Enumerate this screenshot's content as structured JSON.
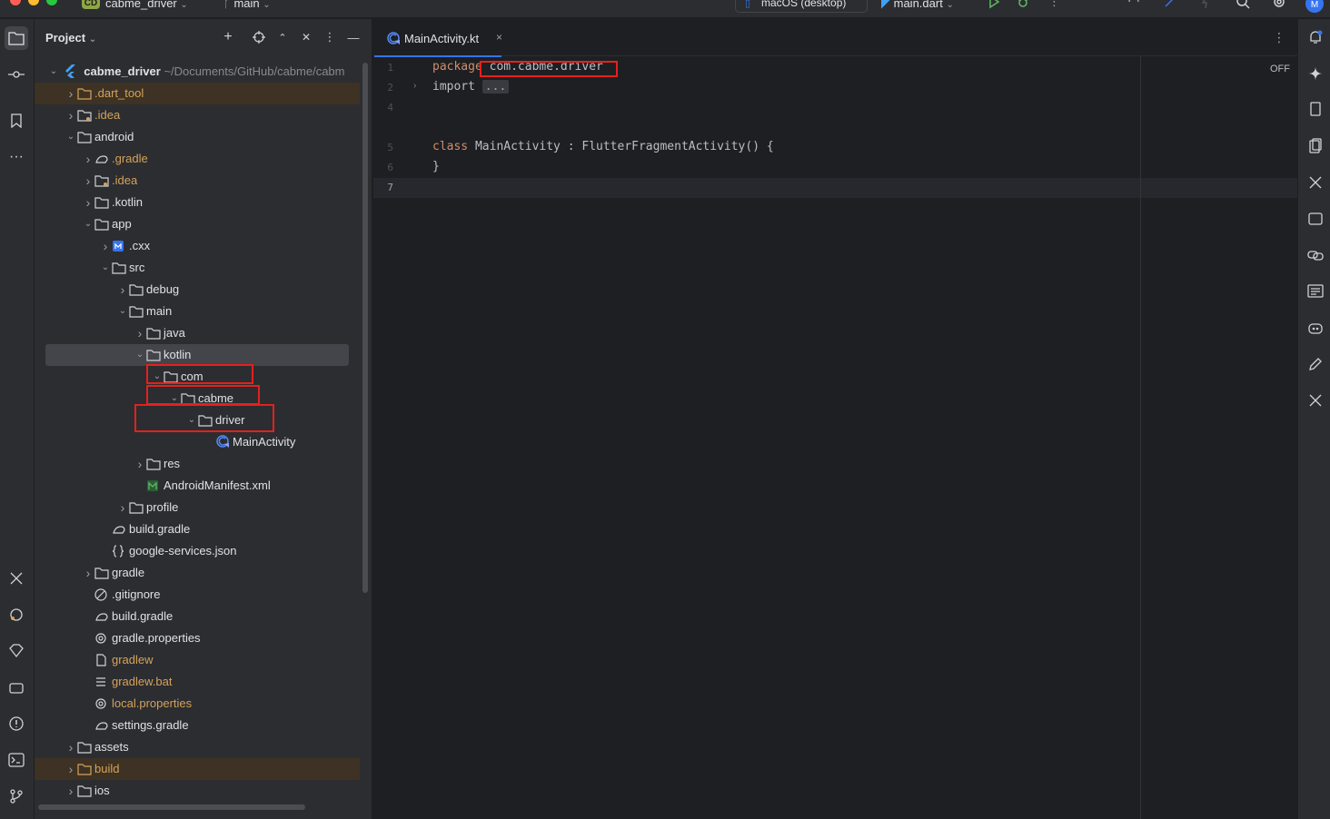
{
  "titlebar": {
    "project_badge": "CD",
    "project_name": "cabme_driver",
    "branch": "main",
    "run_target": "macOS (desktop)",
    "run_file": "main.dart",
    "avatar": "M"
  },
  "project_panel": {
    "title": "Project",
    "root": {
      "name": "cabme_driver",
      "path": "~/Documents/GitHub/cabme/cabm"
    },
    "tree": [
      {
        "label": ".dart_tool",
        "depth": 1,
        "chev": "right",
        "icon": "folder-excluded-icon",
        "style": "orange",
        "hl": "excluded"
      },
      {
        "label": ".idea",
        "depth": 1,
        "chev": "right",
        "icon": "folder-settings-icon",
        "style": "orange"
      },
      {
        "label": "android",
        "depth": 1,
        "chev": "down",
        "icon": "folder-icon",
        "style": "normal"
      },
      {
        "label": ".gradle",
        "depth": 2,
        "chev": "right",
        "icon": "gradle-folder-icon",
        "style": "orange"
      },
      {
        "label": ".idea",
        "depth": 2,
        "chev": "right",
        "icon": "folder-settings-icon",
        "style": "orange"
      },
      {
        "label": ".kotlin",
        "depth": 2,
        "chev": "right",
        "icon": "folder-icon",
        "style": "normal"
      },
      {
        "label": "app",
        "depth": 2,
        "chev": "down",
        "icon": "folder-icon",
        "style": "normal"
      },
      {
        "label": ".cxx",
        "depth": 3,
        "chev": "right",
        "icon": "module-icon",
        "style": "normal"
      },
      {
        "label": "src",
        "depth": 3,
        "chev": "down",
        "icon": "folder-icon",
        "style": "normal"
      },
      {
        "label": "debug",
        "depth": 4,
        "chev": "right",
        "icon": "folder-icon",
        "style": "normal"
      },
      {
        "label": "main",
        "depth": 4,
        "chev": "down",
        "icon": "folder-icon",
        "style": "normal"
      },
      {
        "label": "java",
        "depth": 5,
        "chev": "right",
        "icon": "folder-icon",
        "style": "normal"
      },
      {
        "label": "kotlin",
        "depth": 5,
        "chev": "down",
        "icon": "folder-icon",
        "style": "normal",
        "hl": "selected"
      },
      {
        "label": "com",
        "depth": 6,
        "chev": "down",
        "icon": "folder-icon",
        "style": "normal"
      },
      {
        "label": "cabme",
        "depth": 7,
        "chev": "down",
        "icon": "folder-icon",
        "style": "normal"
      },
      {
        "label": "driver",
        "depth": 8,
        "chev": "down",
        "icon": "folder-icon",
        "style": "normal"
      },
      {
        "label": "MainActivity",
        "depth": 9,
        "chev": "none",
        "icon": "kotlin-class-icon",
        "style": "normal"
      },
      {
        "label": "res",
        "depth": 5,
        "chev": "right",
        "icon": "folder-icon",
        "style": "normal"
      },
      {
        "label": "AndroidManifest.xml",
        "depth": 5,
        "chev": "none",
        "icon": "manifest-icon",
        "style": "normal"
      },
      {
        "label": "profile",
        "depth": 4,
        "chev": "right",
        "icon": "folder-icon",
        "style": "normal"
      },
      {
        "label": "build.gradle",
        "depth": 3,
        "chev": "none",
        "icon": "gradle-icon",
        "style": "normal"
      },
      {
        "label": "google-services.json",
        "depth": 3,
        "chev": "none",
        "icon": "json-icon",
        "style": "normal"
      },
      {
        "label": "gradle",
        "depth": 2,
        "chev": "right",
        "icon": "folder-icon",
        "style": "normal"
      },
      {
        "label": ".gitignore",
        "depth": 2,
        "chev": "none",
        "icon": "ignore-icon",
        "style": "normal"
      },
      {
        "label": "build.gradle",
        "depth": 2,
        "chev": "none",
        "icon": "gradle-icon",
        "style": "normal"
      },
      {
        "label": "gradle.properties",
        "depth": 2,
        "chev": "none",
        "icon": "properties-icon",
        "style": "normal"
      },
      {
        "label": "gradlew",
        "depth": 2,
        "chev": "none",
        "icon": "file-icon",
        "style": "orange"
      },
      {
        "label": "gradlew.bat",
        "depth": 2,
        "chev": "none",
        "icon": "text-file-icon",
        "style": "orange"
      },
      {
        "label": "local.properties",
        "depth": 2,
        "chev": "none",
        "icon": "properties-icon",
        "style": "orange"
      },
      {
        "label": "settings.gradle",
        "depth": 2,
        "chev": "none",
        "icon": "gradle-icon",
        "style": "normal"
      },
      {
        "label": "assets",
        "depth": 1,
        "chev": "right",
        "icon": "folder-icon",
        "style": "normal"
      },
      {
        "label": "build",
        "depth": 1,
        "chev": "right",
        "icon": "folder-excluded-icon",
        "style": "orange",
        "hl": "excluded"
      },
      {
        "label": "ios",
        "depth": 1,
        "chev": "right",
        "icon": "folder-icon",
        "style": "normal"
      }
    ]
  },
  "editor": {
    "tab_label": "MainActivity.kt",
    "tab_close": "×",
    "inlay_off": "OFF",
    "line_numbers": [
      "1",
      "2",
      "4",
      "5",
      "6",
      "7"
    ],
    "lines": [
      {
        "kw": "package",
        "rest": " com.cabme.driver"
      },
      {
        "kw": "import",
        "rest": " ",
        "folded": "..."
      },
      {
        "kw": "",
        "rest": ""
      },
      {
        "kw": "class",
        "rest": " MainActivity : FlutterFragmentActivity() {"
      },
      {
        "kw": "",
        "rest": "}"
      },
      {
        "kw": "",
        "rest": ""
      }
    ]
  },
  "colors": {
    "accent": "#3574f0",
    "annotation_red": "#e5201d",
    "excluded_text": "#d6a25a",
    "keyword": "#cf8e6d"
  }
}
